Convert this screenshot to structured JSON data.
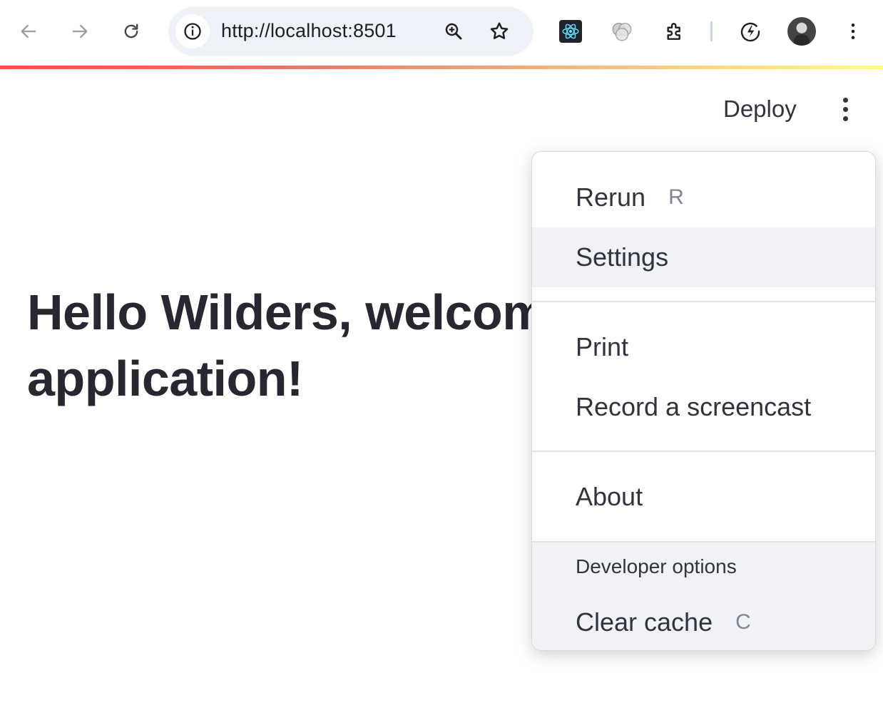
{
  "browser": {
    "url": "http://localhost:8501"
  },
  "header": {
    "deploy_label": "Deploy"
  },
  "main": {
    "title_line1": "Hello Wilders, welcome to our",
    "title_line2": "application!"
  },
  "menu": {
    "rerun_label": "Rerun",
    "rerun_shortcut": "R",
    "settings_label": "Settings",
    "print_label": "Print",
    "record_label": "Record a screencast",
    "about_label": "About",
    "developer_options_label": "Developer options",
    "clear_cache_label": "Clear cache",
    "clear_cache_shortcut": "C"
  },
  "colors": {
    "accent_gradient": [
      "#ff4b4b",
      "#fffd80"
    ],
    "hover_background": "#f0f2f6",
    "text": "#31333f"
  },
  "icons": [
    "back-arrow-icon",
    "forward-arrow-icon",
    "reload-icon",
    "site-info-icon",
    "zoom-icon",
    "bookmark-star-icon",
    "react-devtools-icon",
    "extension-icon",
    "puzzle-extensions-icon",
    "speed-icon",
    "profile-avatar",
    "browser-menu-icon"
  ]
}
